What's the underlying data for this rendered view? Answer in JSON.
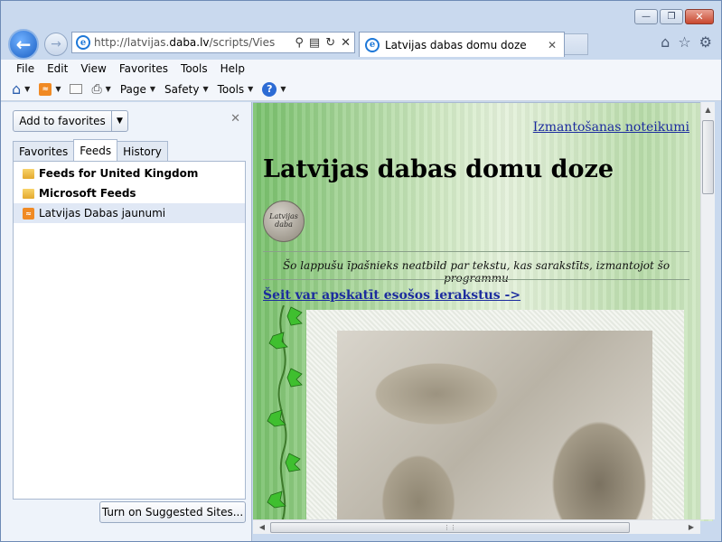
{
  "browser": {
    "address": {
      "prefix": "http://latvijas.",
      "domain": "daba.lv",
      "suffix": "/scripts/ViesuGra"
    },
    "tab": {
      "title": "Latvijas dabas domu doze"
    },
    "caption": {
      "minimize": "—",
      "restore": "❐",
      "close": "✕"
    },
    "icons": [
      "back-arrow-icon",
      "forward-arrow-icon",
      "ie-logo-icon",
      "search-icon",
      "compatibility-icon",
      "refresh-icon",
      "stop-icon",
      "home-icon",
      "star-icon",
      "gear-icon"
    ]
  },
  "menubar": [
    "File",
    "Edit",
    "View",
    "Favorites",
    "Tools",
    "Help"
  ],
  "commandbar": {
    "page": "Page",
    "safety": "Safety",
    "tools": "Tools"
  },
  "favorites_pane": {
    "add_button": "Add to favorites",
    "tabs": [
      "Favorites",
      "Feeds",
      "History"
    ],
    "active_tab": "Feeds",
    "feeds": [
      {
        "label": "Feeds for United Kingdom",
        "type": "folder"
      },
      {
        "label": "Microsoft Feeds",
        "type": "folder"
      },
      {
        "label": "Latvijas Dabas jaunumi",
        "type": "feed"
      }
    ],
    "suggested_button": "Turn on Suggested Sites..."
  },
  "page": {
    "terms_link": "Izmantošanas noteikumi",
    "title": "Latvijas dabas domu doze",
    "logo_text_top": "Latvijas",
    "logo_text_bottom": "daba",
    "disclaimer": "Šo lappušu īpašnieks neatbild par tekstu, kas sarakstīts, izmantojot šo programmu",
    "entries_link": "Šeit var apskatīt esošos ierakstus ->"
  },
  "colors": {
    "link": "#1c2c9e",
    "page_bg_green": "#a3d395",
    "accent_blue": "#1b5fc2"
  }
}
